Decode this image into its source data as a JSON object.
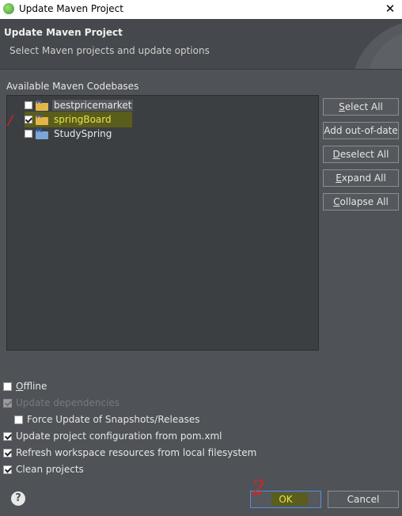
{
  "window": {
    "title": "Update Maven Project",
    "close_glyph": "✕"
  },
  "header": {
    "title": "Update Maven Project",
    "subtitle": "Select Maven projects and update options"
  },
  "codebases": {
    "label": "Available Maven Codebases",
    "items": [
      {
        "name": "bestpricemarket",
        "checked": false,
        "icon": "maven-project-folder-icon"
      },
      {
        "name": "springBoard",
        "checked": true,
        "icon": "maven-project-folder-icon"
      },
      {
        "name": "StudySpring",
        "checked": false,
        "icon": "maven-project-folder-icon"
      }
    ]
  },
  "side_buttons": {
    "select_all": {
      "mnemonic": "S",
      "rest": "elect All"
    },
    "add_out_of_date": "Add out-of-date",
    "deselect_all": {
      "mnemonic": "D",
      "rest": "eselect All"
    },
    "expand_all": {
      "mnemonic": "E",
      "rest": "xpand All"
    },
    "collapse_all": {
      "mnemonic": "C",
      "rest": "ollapse All"
    }
  },
  "options": {
    "offline": {
      "mnemonic": "O",
      "rest": "ffline",
      "checked": false
    },
    "update_dependencies": {
      "label": "Update dependencies",
      "checked": true,
      "disabled": true
    },
    "force_update": {
      "label": "Force Update of Snapshots/Releases",
      "checked": false
    },
    "update_config": {
      "label": "Update project configuration from pom.xml",
      "checked": true
    },
    "refresh_workspace": {
      "label": "Refresh workspace resources from local filesystem",
      "checked": true
    },
    "clean_projects": {
      "label": "Clean projects",
      "checked": true
    }
  },
  "footer": {
    "help_glyph": "?",
    "ok_label": "OK",
    "cancel_label": "Cancel"
  },
  "annotations": {
    "mark_1": "/",
    "mark_2": "2"
  },
  "colors": {
    "highlight": "#e9e44a",
    "annotation": "#d82323",
    "background": "#4f5256"
  }
}
